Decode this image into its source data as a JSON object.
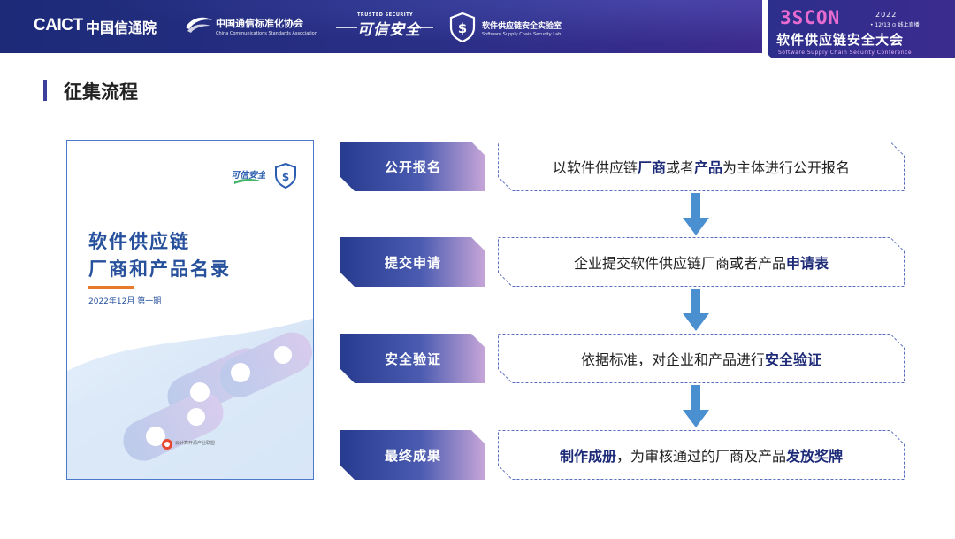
{
  "header": {
    "caict_logo": "CAICT",
    "caict_cn": "中国信通院",
    "ccsa_cn": "中国通信标准化协会",
    "ccsa_en": "China Communications Standards Association",
    "trusted_top": "TRUSTED SECURITY",
    "trusted_main": "可信安全",
    "lab_cn": "软件供应链安全实验室",
    "lab_en": "Software Supply Chain Security Lab",
    "conference": {
      "name": "3SCON",
      "year": "2022",
      "date": "• 12/13  ⊙ 线上直播",
      "title": "软件供应链安全大会",
      "subtitle": "Software Supply Chain Security Conference"
    }
  },
  "page_title": "征集流程",
  "cover": {
    "title_line1": "软件供应链",
    "title_line2": "厂商和产品名录",
    "date": "2022年12月   第一期",
    "logo_text": "可信安全",
    "publisher": "云计算开源产业联盟"
  },
  "steps": [
    {
      "label": "公开报名",
      "desc": [
        {
          "t": "以软件供应链",
          "h": false
        },
        {
          "t": "厂商",
          "h": true
        },
        {
          "t": "或者",
          "h": false
        },
        {
          "t": "产品",
          "h": true
        },
        {
          "t": "为主体进行公开报名",
          "h": false
        }
      ]
    },
    {
      "label": "提交申请",
      "desc": [
        {
          "t": "企业提交软件供应链厂商或者产品",
          "h": false
        },
        {
          "t": "申请表",
          "h": true
        }
      ]
    },
    {
      "label": "安全验证",
      "desc": [
        {
          "t": "依据标准，对企业和产品进行",
          "h": false
        },
        {
          "t": "安全验证",
          "h": true
        }
      ]
    },
    {
      "label": "最终成果",
      "desc": [
        {
          "t": "制作成册",
          "h": true
        },
        {
          "t": "，为审核通过的厂商及产品",
          "h": false
        },
        {
          "t": "发放奖牌",
          "h": true
        }
      ]
    }
  ],
  "colors": {
    "header_bg": "#1c2a78",
    "label_gradient_start": "#273b8f",
    "label_gradient_end": "#c7a6d8",
    "arrow": "#4a90d0",
    "highlight": "#1c2a78",
    "cover_title": "#264f9c",
    "conf_name": "#e86bd0"
  },
  "icons": [
    "ccsa-swoosh-icon",
    "shield-dollar-icon",
    "down-arrow-icon",
    "chain-link-icon"
  ]
}
